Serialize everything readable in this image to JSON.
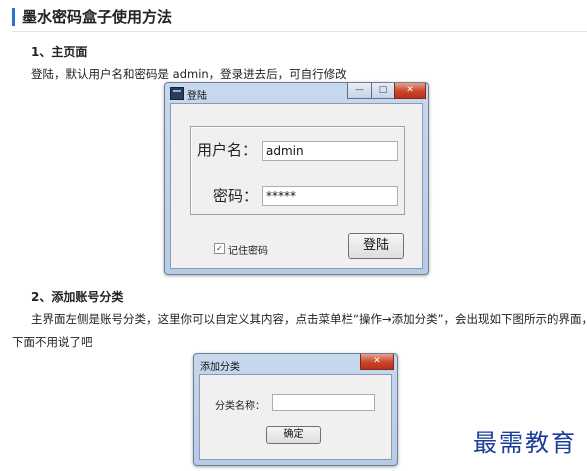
{
  "article": {
    "title": "墨水密码盒子使用方法",
    "section1": {
      "heading": "1、主页面",
      "text": "登陆，默认用户名和密码是 admin，登录进去后，可自行修改"
    },
    "section2": {
      "heading": "2、添加账号分类",
      "text_line1": "主界面左侧是账号分类，这里你可以自定义其内容，点击菜单栏“操作→添加分类”，会出现如下图所示的界面，",
      "text_line2": "下面不用说了吧"
    }
  },
  "login_dialog": {
    "title": "登陆",
    "minimize_glyph": "—",
    "maximize_glyph": "□",
    "close_glyph": "✕",
    "username_label": "用户名：",
    "username_value": "admin",
    "password_label": "密码：",
    "password_value": "*****",
    "remember_checked": true,
    "remember_glyph": "✓",
    "remember_label": "记住密码",
    "login_button": "登陆"
  },
  "add_category_dialog": {
    "title": "添加分类",
    "close_glyph": "✕",
    "name_label": "分类名称：",
    "name_value": "",
    "ok_button": "确定"
  },
  "watermark": "最需教育",
  "colors": {
    "accent": "#2b6fd4",
    "window_frame": "#b6cbe6",
    "close_button": "#c9442b",
    "watermark": "#1a3d9c"
  }
}
